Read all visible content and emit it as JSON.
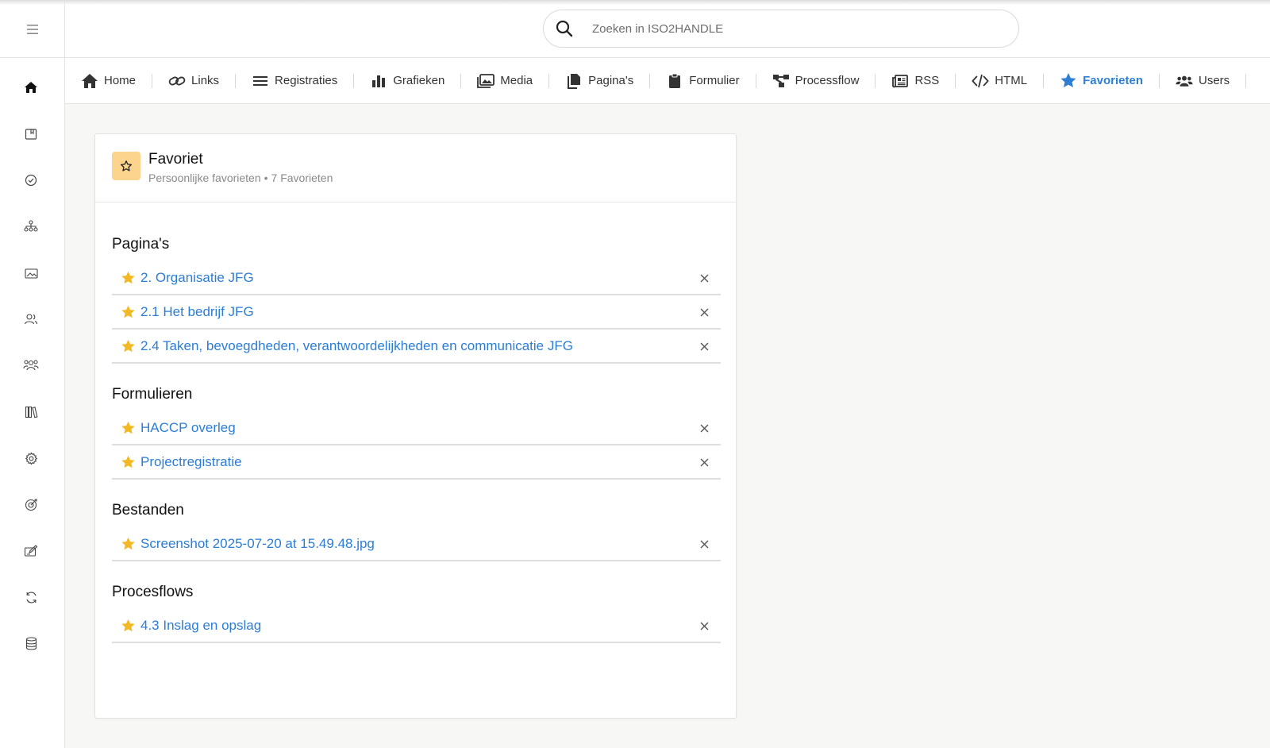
{
  "topbar": {
    "menu_icon": "hamburger-icon",
    "search": {
      "placeholder": "Zoeken in ISO2HANDLE",
      "value": "",
      "icon": "search-icon"
    }
  },
  "sidebar": {
    "items": [
      {
        "icon": "home-icon"
      },
      {
        "icon": "book-icon"
      },
      {
        "icon": "check-circle-icon"
      },
      {
        "icon": "org-chart-icon"
      },
      {
        "icon": "image-folder-icon"
      },
      {
        "icon": "users-icon"
      },
      {
        "icon": "group-icon"
      },
      {
        "icon": "library-icon"
      },
      {
        "icon": "gear-icon"
      },
      {
        "icon": "target-icon"
      },
      {
        "icon": "edit-box-icon"
      },
      {
        "icon": "sync-icon"
      },
      {
        "icon": "database-icon"
      }
    ]
  },
  "nav": {
    "tabs": [
      {
        "label": "Home",
        "icon": "home-icon"
      },
      {
        "label": "Links",
        "icon": "link-icon"
      },
      {
        "label": "Registraties",
        "icon": "list-icon"
      },
      {
        "label": "Grafieken",
        "icon": "bar-chart-icon"
      },
      {
        "label": "Media",
        "icon": "images-icon"
      },
      {
        "label": "Pagina's",
        "icon": "pages-icon"
      },
      {
        "label": "Formulier",
        "icon": "clipboard-icon"
      },
      {
        "label": "Processflow",
        "icon": "flow-icon"
      },
      {
        "label": "RSS",
        "icon": "newspaper-icon"
      },
      {
        "label": "HTML",
        "icon": "code-icon"
      },
      {
        "label": "Favorieten",
        "icon": "star-icon",
        "active": true
      },
      {
        "label": "Users",
        "icon": "users-icon"
      }
    ]
  },
  "card": {
    "title": "Favoriet",
    "subtitle_left": "Persoonlijke favorieten",
    "subtitle_sep": "•",
    "subtitle_right": "7 Favorieten",
    "sections": [
      {
        "title": "Pagina's",
        "items": [
          "2. Organisatie JFG",
          "2.1 Het bedrijf JFG",
          "2.4 Taken, bevoegdheden, verantwoordelijkheden en communicatie JFG"
        ]
      },
      {
        "title": "Formulieren",
        "items": [
          "HACCP overleg",
          "Projectregistratie"
        ]
      },
      {
        "title": "Bestanden",
        "items": [
          "Screenshot 2025-07-20 at 15.49.48.jpg"
        ]
      },
      {
        "title": "Procesflows",
        "items": [
          "4.3 Inslag en opslag"
        ]
      }
    ]
  },
  "colors": {
    "accent": "#2e7fd3",
    "link": "#2b7dd5",
    "star": "#f2b924",
    "badge_bg": "#fcd48e"
  }
}
